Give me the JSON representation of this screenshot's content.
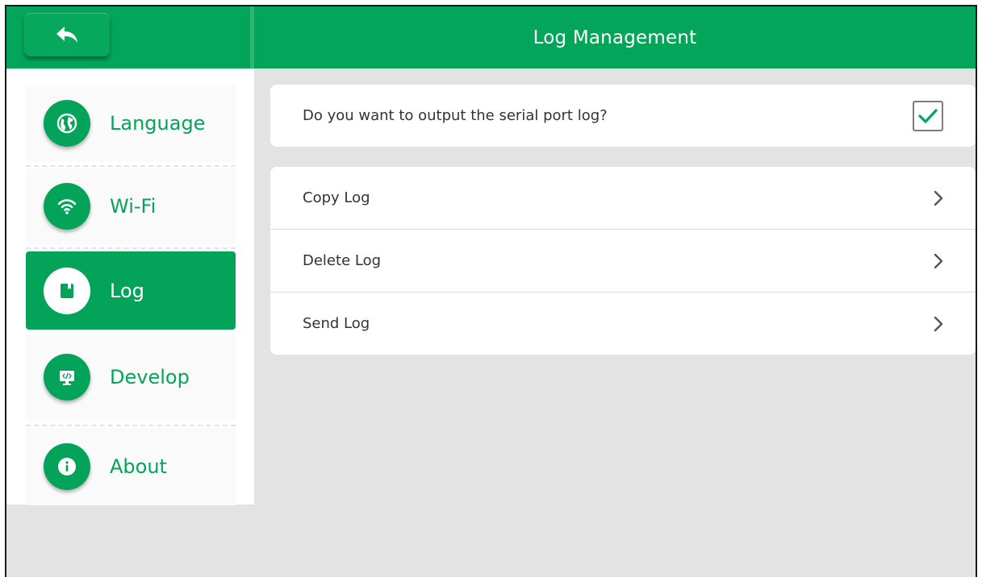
{
  "header": {
    "title": "Log Management",
    "back_icon": "back-arrow-icon"
  },
  "sidebar": {
    "items": [
      {
        "label": "Language",
        "icon": "globe-icon",
        "active": false
      },
      {
        "label": "Wi-Fi",
        "icon": "wifi-icon",
        "active": false
      },
      {
        "label": "Log",
        "icon": "book-icon",
        "active": true
      },
      {
        "label": "Develop",
        "icon": "code-monitor-icon",
        "active": false
      },
      {
        "label": "About",
        "icon": "info-icon",
        "active": false
      }
    ]
  },
  "main": {
    "serial_log": {
      "question": "Do you want to output the serial port log?",
      "checked": true
    },
    "actions": [
      {
        "label": "Copy Log"
      },
      {
        "label": "Delete Log"
      },
      {
        "label": "Send Log"
      }
    ]
  },
  "colors": {
    "accent": "#02a55a",
    "background": "#e3e3e3",
    "card": "#ffffff",
    "text": "#333333"
  }
}
